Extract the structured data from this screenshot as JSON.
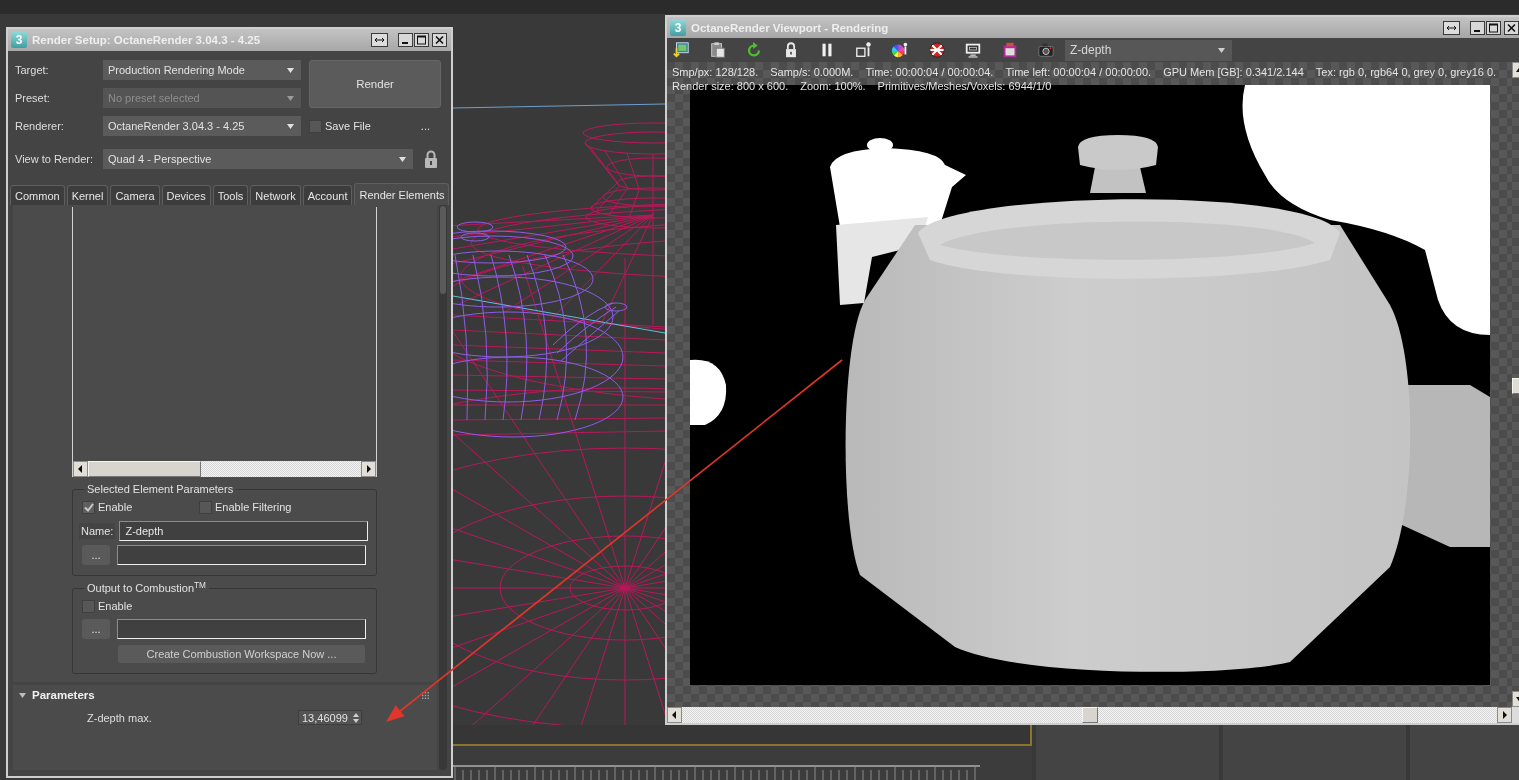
{
  "render_setup": {
    "app_icon": "3",
    "title": "Render Setup: OctaneRender 3.04.3 - 4.25",
    "fields": [
      {
        "label": "Target:",
        "value": "Production Rendering Mode",
        "disabled": false
      },
      {
        "label": "Preset:",
        "value": "No preset selected",
        "disabled": true
      },
      {
        "label": "Renderer:",
        "value": "OctaneRender 3.04.3 - 4.25",
        "disabled": false
      }
    ],
    "render_button": "Render",
    "save_file": {
      "label": "Save File",
      "checked": false
    },
    "more_button": "...",
    "view_to_render": {
      "label": "View to Render:",
      "value": "Quad 4 - Perspective"
    },
    "tabs": [
      {
        "label": "Common",
        "selected": false
      },
      {
        "label": "Kernel",
        "selected": false
      },
      {
        "label": "Camera",
        "selected": false
      },
      {
        "label": "Devices",
        "selected": false
      },
      {
        "label": "Tools",
        "selected": false
      },
      {
        "label": "Network",
        "selected": false
      },
      {
        "label": "Account",
        "selected": false
      },
      {
        "label": "Render Elements",
        "selected": true
      }
    ],
    "selected_element_parameters": {
      "title": "Selected Element Parameters",
      "enable": {
        "label": "Enable",
        "checked": true
      },
      "enable_filtering": {
        "label": "Enable Filtering",
        "checked": false
      },
      "name_label": "Name:",
      "name": "Z-depth",
      "browse_button": "..."
    },
    "output_to_combustion": {
      "title": "Output to Combustion$^{TM}$",
      "enable": {
        "label": "Enable",
        "checked": false
      },
      "browse_button": "...",
      "create_button": "Create Combustion Workspace Now ..."
    },
    "parameters": {
      "title": "Parameters",
      "expanded": true,
      "label": "Z-depth max.",
      "value": "13,46099"
    }
  },
  "viewport": {
    "app_icon": "3",
    "title": "OctaneRender Viewport - Rendering",
    "pass": "Z-depth",
    "stats": [
      {
        "items": [
          "Smp/px: 128/128.",
          "Samp/s: 0.000M.",
          "Time: 00:00:04 / 00:00:04.",
          "Time left: 00:00:04 / 00:00:00.",
          "GPU Mem [GB]: 0.341/2.144",
          "Tex: rgb 0, rgb64 0, grey 0, grey16 0."
        ]
      },
      {
        "items": [
          "Render size: 800 x 600.",
          "Zoom: 100%.",
          "Primitives/Meshes/Voxels: 6944/1/0"
        ]
      }
    ]
  }
}
